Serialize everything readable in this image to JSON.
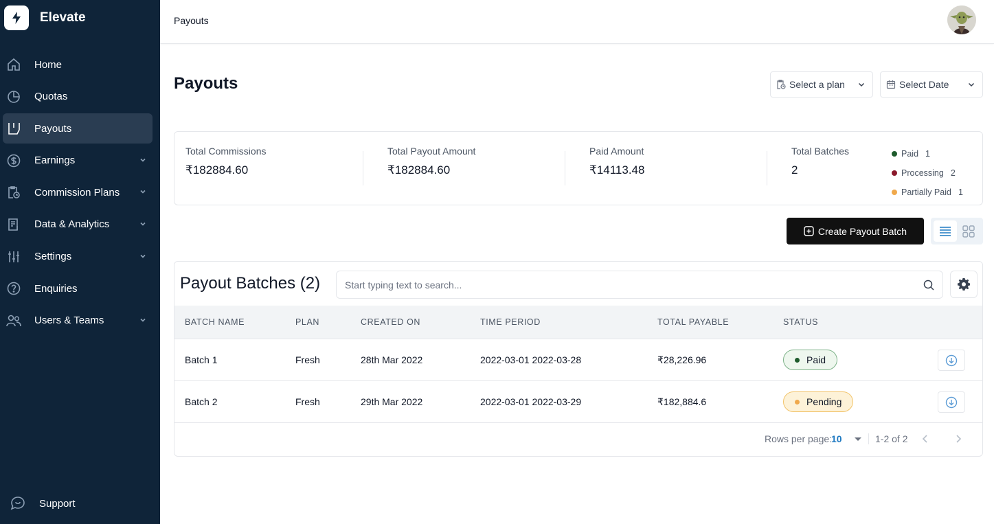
{
  "app": {
    "name": "Elevate"
  },
  "sidebar": {
    "items": [
      {
        "label": "Home",
        "icon": "home-icon",
        "active": false,
        "expandable": false
      },
      {
        "label": "Quotas",
        "icon": "pie-chart-icon",
        "active": false,
        "expandable": false
      },
      {
        "label": "Payouts",
        "icon": "payouts-icon",
        "active": true,
        "expandable": false
      },
      {
        "label": "Earnings",
        "icon": "dollar-circle-icon",
        "active": false,
        "expandable": true
      },
      {
        "label": "Commission Plans",
        "icon": "clipboard-clock-icon",
        "active": false,
        "expandable": true
      },
      {
        "label": "Data & Analytics",
        "icon": "document-chart-icon",
        "active": false,
        "expandable": true
      },
      {
        "label": "Settings",
        "icon": "sliders-icon",
        "active": false,
        "expandable": true
      },
      {
        "label": "Enquiries",
        "icon": "question-circle-icon",
        "active": false,
        "expandable": false
      },
      {
        "label": "Users & Teams",
        "icon": "users-icon",
        "active": false,
        "expandable": true
      }
    ],
    "support_label": "Support"
  },
  "topbar": {
    "breadcrumb": "Payouts"
  },
  "header": {
    "title": "Payouts",
    "plan_select": "Select a plan",
    "date_select": "Select Date"
  },
  "stats": {
    "total_commissions": {
      "label": "Total Commissions",
      "value": "₹182884.60"
    },
    "total_payout": {
      "label": "Total Payout Amount",
      "value": "₹182884.60"
    },
    "paid_amount": {
      "label": "Paid Amount",
      "value": "₹14113.48"
    },
    "total_batches": {
      "label": "Total Batches",
      "value": "2"
    },
    "legend": [
      {
        "label": "Paid",
        "count": "1",
        "color": "#1e5b2c"
      },
      {
        "label": "Processing",
        "count": "2",
        "color": "#8b1a2b"
      },
      {
        "label": "Partially Paid",
        "count": "1",
        "color": "#f0a94c"
      }
    ]
  },
  "actions": {
    "create_label": "Create Payout Batch"
  },
  "table": {
    "title": "Payout Batches (2)",
    "search_placeholder": "Start typing text to search...",
    "columns": [
      "BATCH NAME",
      "PLAN",
      "CREATED ON",
      "TIME PERIOD",
      "TOTAL PAYABLE",
      "STATUS"
    ],
    "rows": [
      {
        "batch": "Batch 1",
        "plan": "Fresh",
        "created": "28th Mar 2022",
        "period": "2022-03-01 2022-03-28",
        "payable": "₹28,226.96",
        "status": "Paid",
        "status_color": "#1e5b2c"
      },
      {
        "batch": "Batch 2",
        "plan": "Fresh",
        "created": "29th Mar 2022",
        "period": "2022-03-01 2022-03-29",
        "payable": "₹182,884.6",
        "status": "Pending",
        "status_color": "#f0a94c"
      }
    ],
    "pagination": {
      "rows_per_page_label": "Rows per page:",
      "rows_per_page": "10",
      "range": "1-2 of 2"
    }
  }
}
